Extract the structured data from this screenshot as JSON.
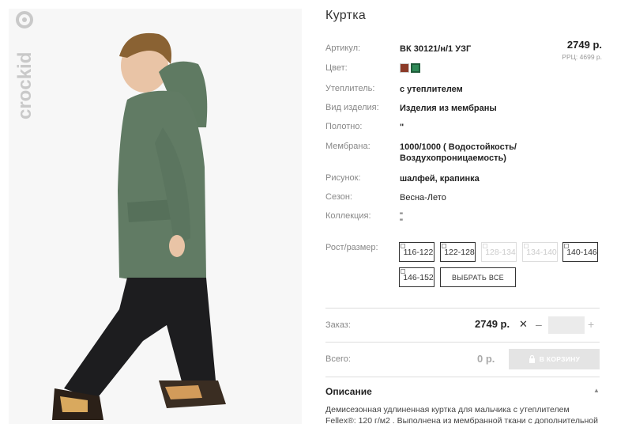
{
  "product": {
    "title": "Куртка",
    "price": "2749 р.",
    "rrp": "РРЦ: 4699 р."
  },
  "attributes": [
    {
      "label": "Артикул:",
      "value": "ВК 30121/н/1 УЗГ"
    },
    {
      "label": "Цвет:",
      "value": ""
    },
    {
      "label": "Утеплитель:",
      "value": "с утеплителем"
    },
    {
      "label": "Вид изделия:",
      "value": "Изделия из мембраны"
    },
    {
      "label": "Полотно:",
      "value": "\""
    },
    {
      "label": "Мембрана:",
      "value_line1": "1000/1000 ( Водостойкость/",
      "value_line2": "Воздухопроницаемость)"
    },
    {
      "label": "Рисунок:",
      "value": "шалфей, крапинка"
    },
    {
      "label": "Сезон:",
      "value": "Весна-Лето"
    },
    {
      "label": "Коллекция:",
      "value_line1": "\"",
      "value_line2": "\""
    }
  ],
  "colors": [
    {
      "name": "brown",
      "hex": "#8b3a28"
    },
    {
      "name": "green",
      "hex": "#2f8a57",
      "selected": true
    }
  ],
  "sizes": {
    "label": "Рост/размер:",
    "options": [
      {
        "label": "116-122",
        "available": true
      },
      {
        "label": "122-128",
        "available": true
      },
      {
        "label": "128-134",
        "available": false
      },
      {
        "label": "134-140",
        "available": false
      },
      {
        "label": "140-146",
        "available": true
      },
      {
        "label": "146-152",
        "available": true
      }
    ],
    "select_all": "ВЫБРАТЬ ВСЕ"
  },
  "order": {
    "label": "Заказ:",
    "price": "2749 р.",
    "remove_symbol": "✕",
    "minus": "–",
    "plus": "+",
    "quantity": ""
  },
  "total": {
    "label": "Всего:",
    "value": "0 р.",
    "cart_button": "В КОРЗИНУ"
  },
  "description": {
    "title": "Описание",
    "text": "Демисезонная удлиненная куртка для мальчика с утеплителем Fellex®: 120 г/м2 . Выполнена из мембранной ткани с дополнительной"
  },
  "brand": {
    "name": "crockid"
  }
}
